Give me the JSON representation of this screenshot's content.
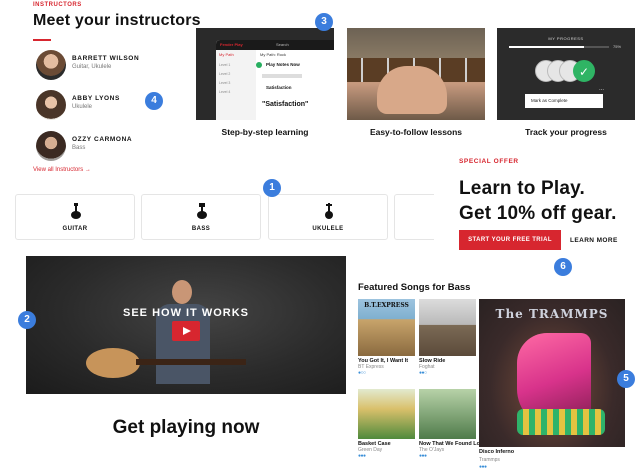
{
  "instructors": {
    "eyebrow": "INSTRUCTORS",
    "title": "Meet your instructors",
    "people": [
      {
        "name": "BARRETT WILSON",
        "instruments": "Guitar, Ukulele"
      },
      {
        "name": "ABBY LYONS",
        "instruments": "Ukulele"
      },
      {
        "name": "OZZY CARMONA",
        "instruments": "Bass"
      }
    ],
    "view_all": "View all Instructors →"
  },
  "features": [
    {
      "caption": "Step-by-step learning"
    },
    {
      "caption": "Easy-to-follow lessons"
    },
    {
      "caption": "Track your progress"
    }
  ],
  "feature_screen": {
    "logo": "Fender Play",
    "search": "Search",
    "side_items": [
      "My Path",
      "Level 1",
      "Level 2",
      "Level 3",
      "Level 4"
    ],
    "path_header": "My Path: Rock",
    "items": [
      "Play Notes Now",
      "Satisfaction",
      "\"Satisfaction\""
    ]
  },
  "progress_card": {
    "label": "MY PROGRESS",
    "percent_text": "75%",
    "progress": 0.75,
    "button": "Mark as Complete",
    "menu": "..."
  },
  "instruments": [
    {
      "label": "GUITAR",
      "icon": "electric-guitar-icon"
    },
    {
      "label": "BASS",
      "icon": "bass-guitar-icon"
    },
    {
      "label": "UKULELE",
      "icon": "ukulele-icon"
    }
  ],
  "offer": {
    "eyebrow": "SPECIAL OFFER",
    "line1": "Learn to Play.",
    "line2": "Get 10% off gear.",
    "cta": "START YOUR FREE TRIAL",
    "learn_more": "LEARN MORE"
  },
  "video": {
    "title": "SEE HOW IT WORKS",
    "play_icon": "play-icon"
  },
  "get_playing": "Get playing now",
  "featured": {
    "title": "Featured Songs for Bass",
    "songs": [
      {
        "title": "You Got It, I Want It",
        "artist": "BT Express",
        "cover_text": "B.T.EXPRESS"
      },
      {
        "title": "Slow Ride",
        "artist": "Foghat"
      },
      {
        "title": "Basket Case",
        "artist": "Green Day"
      },
      {
        "title": "Now That We Found Love",
        "artist": "The O'Jays"
      },
      {
        "title": "Disco Inferno",
        "artist": "Trammps",
        "cover_text": "The TRAMMPS"
      }
    ]
  },
  "markers": [
    "1",
    "2",
    "3",
    "4",
    "5",
    "6"
  ],
  "colors": {
    "accent": "#d7262f",
    "marker": "#3b7ddd",
    "difficulty": "#3a8fd8"
  }
}
